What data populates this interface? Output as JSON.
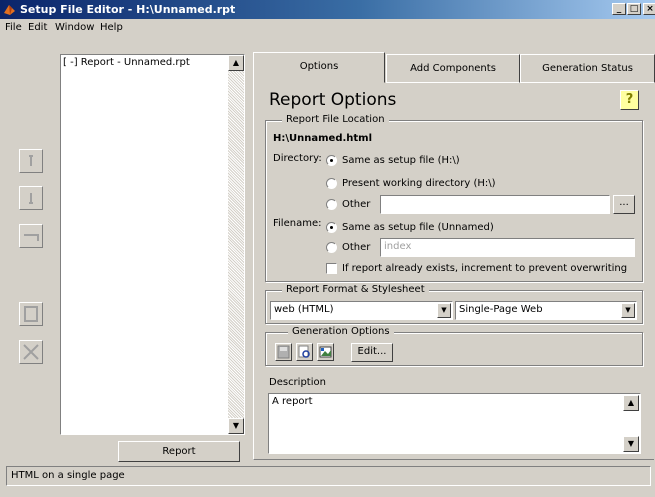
{
  "window": {
    "title": "Setup File Editor - H:\\Unnamed.rpt"
  },
  "menu": [
    "File",
    "Edit",
    "Window",
    "Help"
  ],
  "tree": {
    "items": [
      "[ -] Report - Unnamed.rpt"
    ]
  },
  "left": {
    "report_button": "Report"
  },
  "tabs": [
    "Options",
    "Add Components",
    "Generation Status"
  ],
  "options": {
    "heading": "Report Options",
    "help_label": "?",
    "file_location": {
      "group_title": "Report File Location",
      "path": "H:\\Unnamed.html",
      "directory_label": "Directory:",
      "directory_options": [
        "Same as setup file (H:\\)",
        "Present working directory (H:\\)",
        "Other"
      ],
      "directory_selected": 0,
      "browse_label": "...",
      "filename_label": "Filename:",
      "filename_options": [
        "Same as setup file (Unnamed)",
        "Other"
      ],
      "filename_selected": 0,
      "filename_placeholder": "index",
      "increment_checkbox": "If report already exists, increment to prevent overwriting",
      "increment_checked": false
    },
    "format": {
      "group_title": "Report Format & Stylesheet",
      "format_value": "web (HTML)",
      "stylesheet_value": "Single-Page Web"
    },
    "generation": {
      "group_title": "Generation Options",
      "edit_label": "Edit..."
    },
    "description": {
      "label": "Description",
      "value": "A report"
    }
  },
  "status": {
    "text": "HTML on a single page"
  }
}
